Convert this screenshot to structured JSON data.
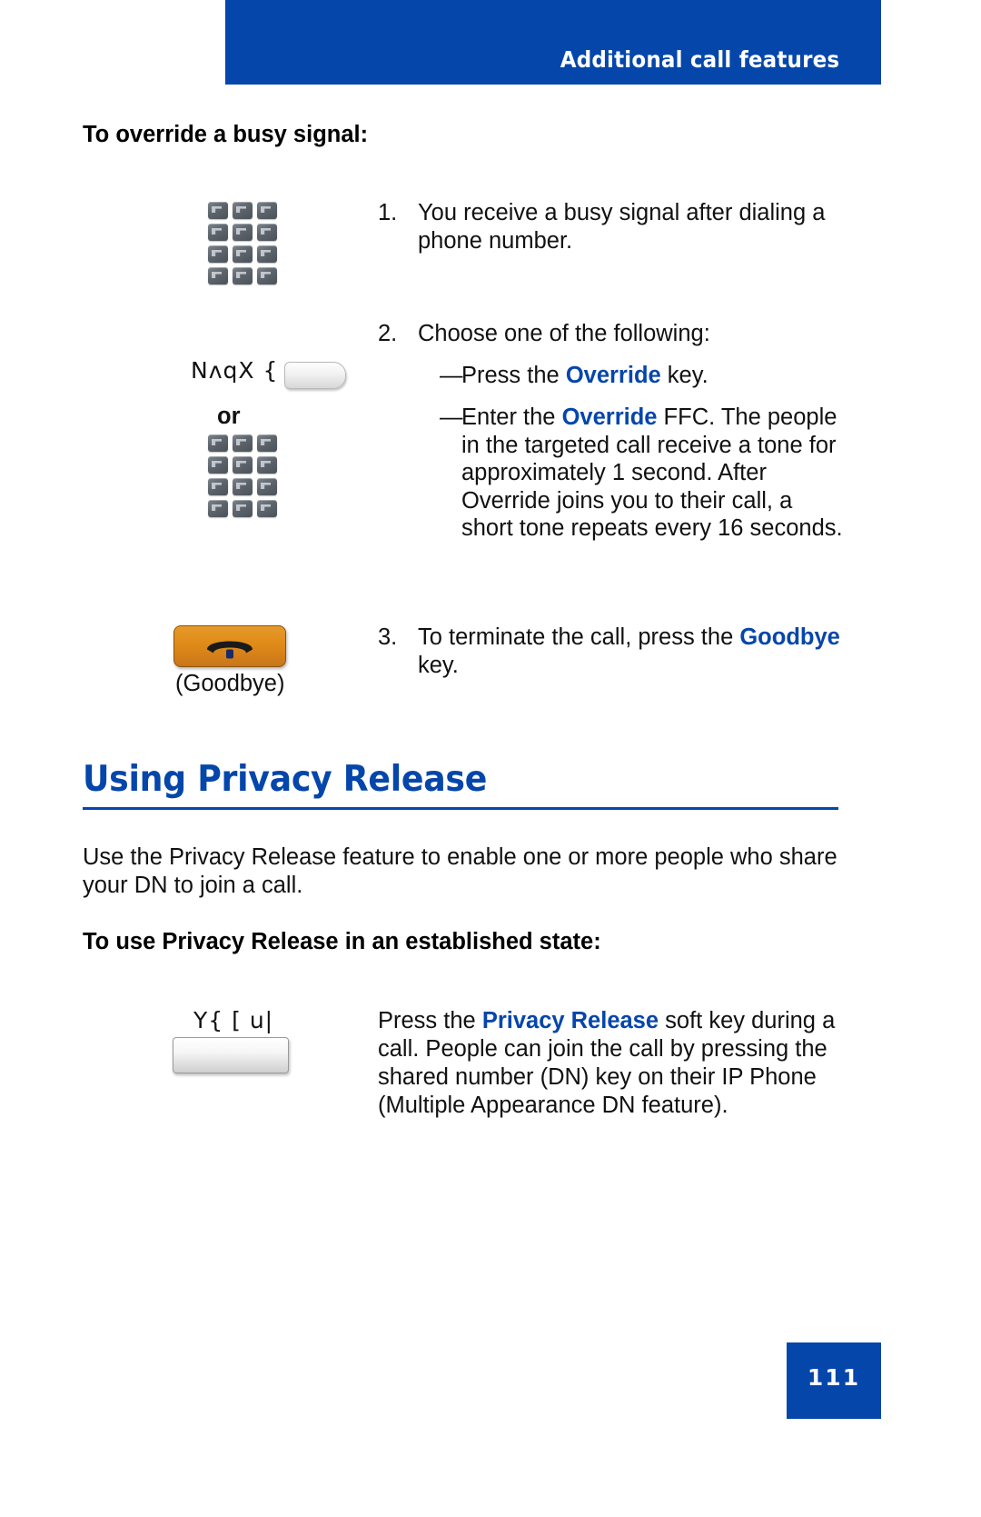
{
  "header": {
    "title": "Additional call features",
    "bar_color": "#0546ab"
  },
  "sections": {
    "override": {
      "heading": "To override a busy signal:",
      "steps": [
        {
          "number": "1.",
          "text": "You receive a busy signal after dialing a phone number."
        },
        {
          "number": "2.",
          "text": "Choose one of the following:"
        },
        {
          "number": "3.",
          "text_before": "To terminate the call, press the ",
          "keyword": "Goodbye",
          "text_after": " key."
        }
      ],
      "bullets": [
        {
          "dash": "—",
          "text_before": "Press the ",
          "keyword": "Override",
          "text_after": " key."
        },
        {
          "dash": "—",
          "text_before": "Enter the ",
          "keyword": "Override",
          "text_after": " FFC. The people in the targeted call receive a tone for approximately 1 second. After Override joins you to their call, a short tone repeats every 16 seconds."
        }
      ],
      "icons": {
        "dialpad_top": "dialpad-icon",
        "softkey_glyph": "NʌqX  {",
        "or_label": "or",
        "dialpad_bottom": "dialpad-icon",
        "goodbye_label": "(Goodbye)"
      }
    },
    "privacy": {
      "title": "Using Privacy Release",
      "intro": "Use the Privacy Release feature to enable one or more people who share your DN to join a call.",
      "heading": "To use Privacy Release in an established state:",
      "softkey_glyph": "Y{  [ u|",
      "instruction_before": "Press the ",
      "instruction_keyword": "Privacy Release",
      "instruction_after": " soft key during a call. People can join the call by pressing the shared number (DN) key on their IP Phone (Multiple Appearance DN feature)."
    }
  },
  "footer": {
    "page_number": "111"
  },
  "colors": {
    "accent_blue": "#0546ab",
    "goodbye_orange": "#e08a18",
    "text": "#111111"
  }
}
